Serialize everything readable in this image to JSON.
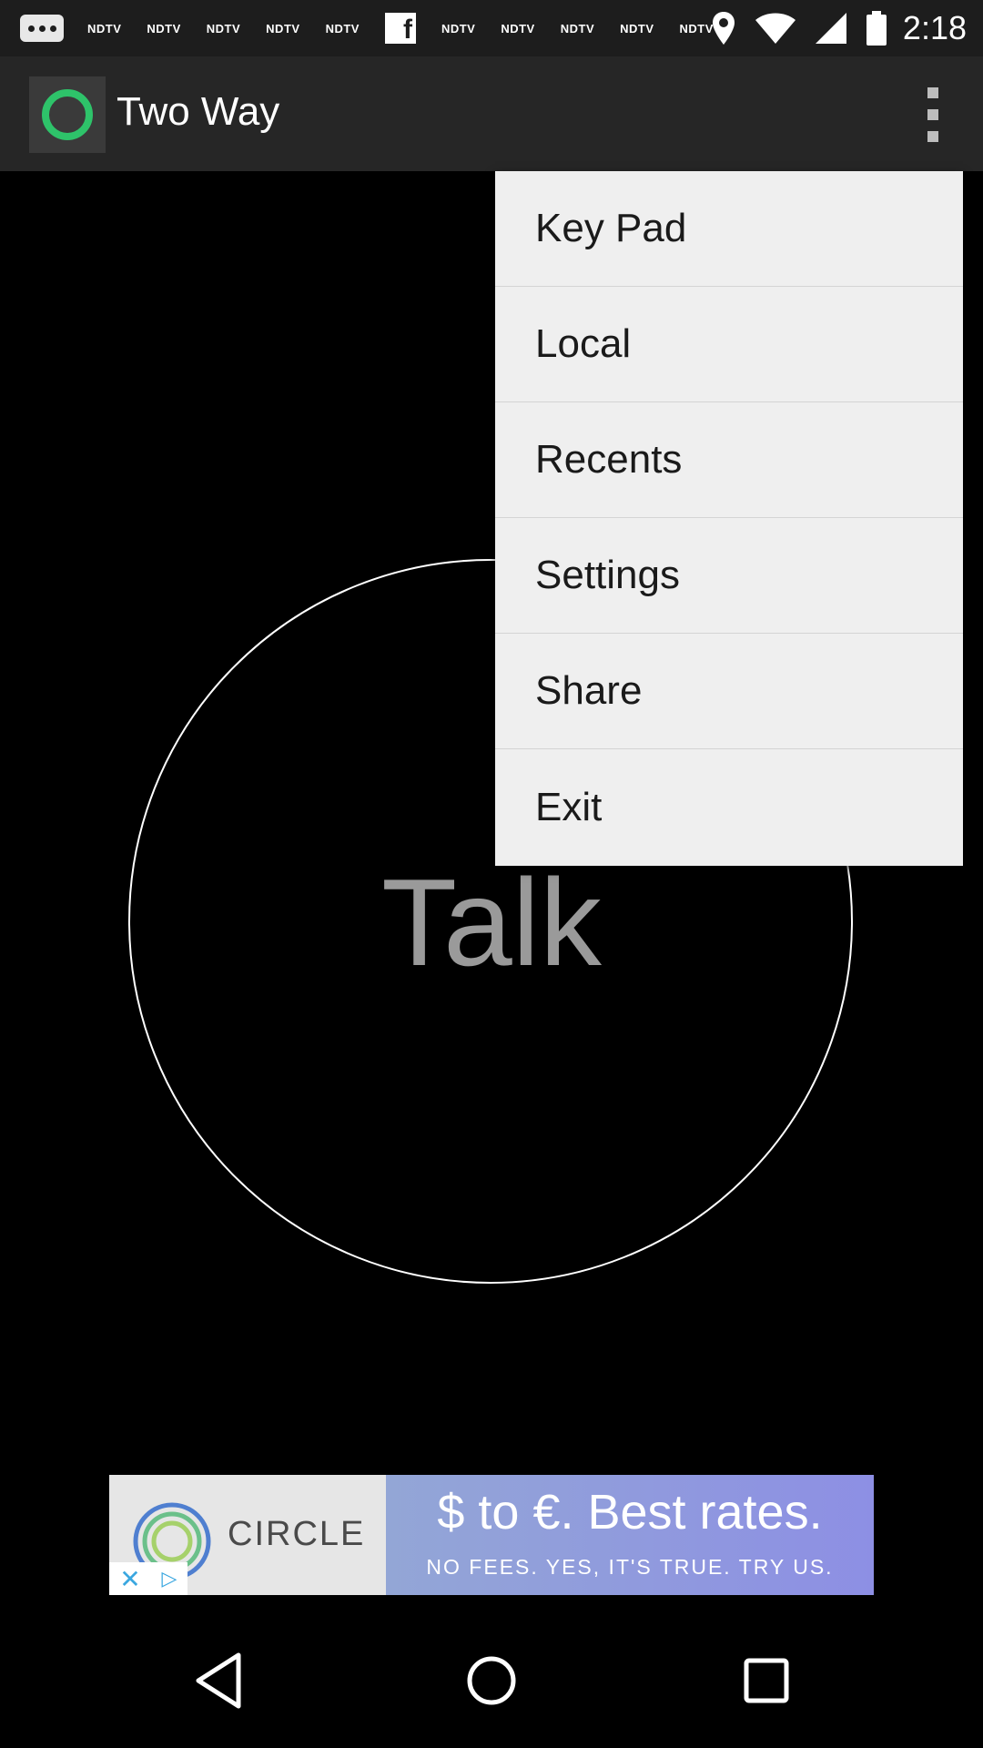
{
  "status_bar": {
    "notifications": [
      "NDTV",
      "NDTV",
      "NDTV",
      "NDTV",
      "NDTV",
      "NDTV",
      "NDTV",
      "NDTV",
      "NDTV",
      "NDTV"
    ],
    "time": "2:18",
    "icons": [
      "dots-icon",
      "facebook-icon",
      "location-icon",
      "wifi-icon",
      "signal-icon",
      "battery-icon"
    ]
  },
  "app_bar": {
    "title": "Two Way",
    "logo_color": "#2ec36a"
  },
  "main": {
    "talk_label": "Talk"
  },
  "menu": {
    "items": [
      "Key Pad",
      "Local",
      "Recents",
      "Settings",
      "Share",
      "Exit"
    ]
  },
  "ad": {
    "brand": "CIRCLE",
    "headline": "$ to €. Best rates.",
    "subline": "NO FEES. YES, IT'S TRUE. TRY US."
  },
  "nav": {
    "icons": [
      "back-icon",
      "home-icon",
      "recents-icon"
    ]
  }
}
